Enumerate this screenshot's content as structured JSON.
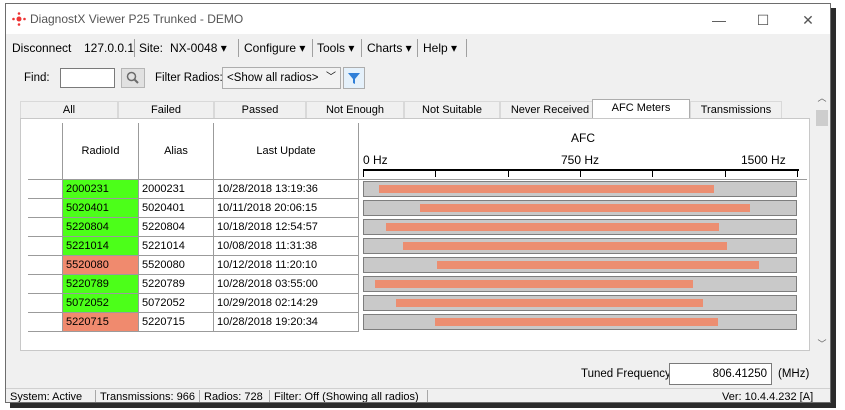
{
  "window": {
    "title": "DiagnostX Viewer P25 Trunked - DEMO",
    "controls": {
      "minimize": "—",
      "maximize": "☐",
      "close": "✕"
    }
  },
  "menubar": {
    "disconnect": "Disconnect",
    "ip": "127.0.0.1",
    "site_label": "Site:",
    "site_value": "NX-0048 ▾",
    "configure": "Configure ▾",
    "tools": "Tools ▾",
    "charts": "Charts ▾",
    "help": "Help ▾"
  },
  "toolbar": {
    "find_label": "Find:",
    "find_value": "",
    "filter_label": "Filter Radios:",
    "filter_value": "<Show all radios>"
  },
  "tabs": [
    "All",
    "Failed",
    "Passed",
    "Not Enough",
    "Not Suitable",
    "Never Received",
    "AFC Meters",
    "Transmissions"
  ],
  "active_tab": "AFC Meters",
  "grid": {
    "columns": {
      "radio_id": "RadioId",
      "alias": "Alias",
      "last_update": "Last Update",
      "afc": "AFC"
    },
    "afc_axis": {
      "min_label": "0 Hz",
      "mid_label": "750 Hz",
      "max_label": "1500 Hz",
      "min": 0,
      "max": 1500
    },
    "rows": [
      {
        "radio_id": "2000231",
        "alias": "2000231",
        "last_update": "10/28/2018 13:19:36",
        "status": "pass",
        "afc_start": 0.035,
        "afc_end": 0.81
      },
      {
        "radio_id": "5020401",
        "alias": "5020401",
        "last_update": "10/11/2018 20:06:15",
        "status": "pass",
        "afc_start": 0.13,
        "afc_end": 0.895
      },
      {
        "radio_id": "5220804",
        "alias": "5220804",
        "last_update": "10/18/2018 12:54:57",
        "status": "pass",
        "afc_start": 0.05,
        "afc_end": 0.82
      },
      {
        "radio_id": "5221014",
        "alias": "5221014",
        "last_update": "10/08/2018 11:31:38",
        "status": "pass",
        "afc_start": 0.09,
        "afc_end": 0.84
      },
      {
        "radio_id": "5520080",
        "alias": "5520080",
        "last_update": "10/12/2018 11:20:10",
        "status": "fail",
        "afc_start": 0.17,
        "afc_end": 0.915
      },
      {
        "radio_id": "5220789",
        "alias": "5220789",
        "last_update": "10/28/2018 03:55:00",
        "status": "pass",
        "afc_start": 0.025,
        "afc_end": 0.76
      },
      {
        "radio_id": "5072052",
        "alias": "5072052",
        "last_update": "10/29/2018 02:14:29",
        "status": "pass",
        "afc_start": 0.075,
        "afc_end": 0.785
      },
      {
        "radio_id": "5220715",
        "alias": "5220715",
        "last_update": "10/28/2018 19:20:34",
        "status": "fail",
        "afc_start": 0.165,
        "afc_end": 0.82
      }
    ]
  },
  "tuned": {
    "label": "Tuned Frequency:",
    "value": "806.41250",
    "unit": "(MHz)"
  },
  "status": {
    "system": "System: Active",
    "transmissions": "Transmissions: 966",
    "radios": "Radios: 728",
    "filter": "Filter: Off (Showing all radios)",
    "version": "Ver: 10.4.4.232 [A]"
  },
  "colors": {
    "pass": "#4cff19",
    "fail": "#f08a6e",
    "bar": "#ec8e71",
    "track": "#c9c9c9"
  }
}
